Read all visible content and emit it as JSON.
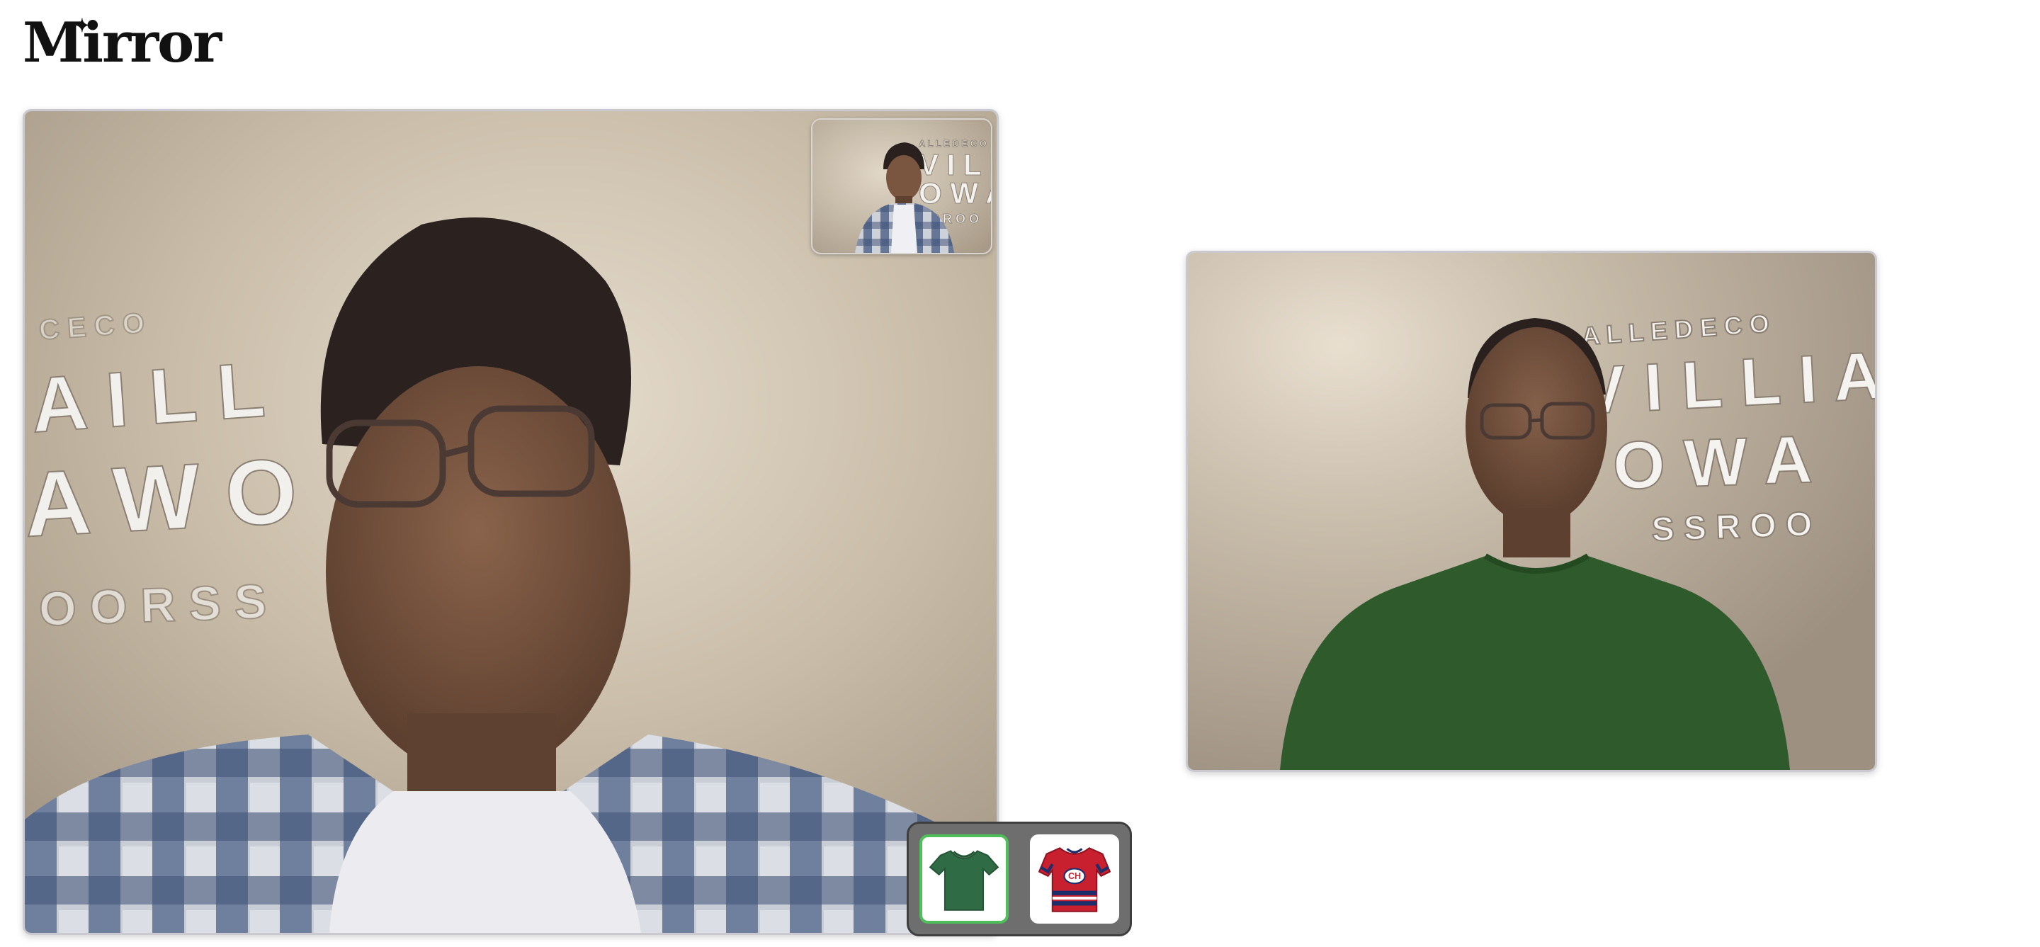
{
  "app": {
    "title": "Mirror"
  },
  "feeds": {
    "camera": {
      "name": "camera-feed"
    },
    "preview": {
      "name": "preview-thumbnail"
    },
    "result": {
      "name": "try-on-result"
    }
  },
  "outfits": [
    {
      "name": "green-tshirt",
      "icon": "tshirt-icon",
      "color": "#2f6b45",
      "selected": true
    },
    {
      "name": "hockey-jersey",
      "icon": "jersey-icon",
      "color": "#c8202f",
      "selected": false
    }
  ],
  "colors": {
    "selected_border": "#4fbf5a",
    "tray_bg": "#6e6e6e",
    "wall": "#cbbfae"
  }
}
